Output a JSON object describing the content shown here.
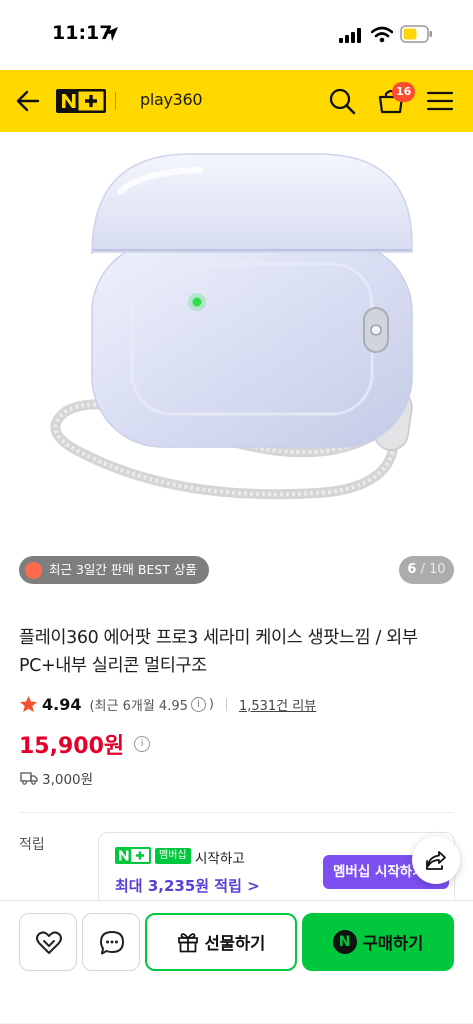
{
  "status_bar": {
    "time": "11:17"
  },
  "header": {
    "logo_text": "N+",
    "store_name": "play360",
    "cart_count": "16",
    "brand_color": "#ffd800"
  },
  "gallery": {
    "badge": "최근 3일간 판매 BEST 상품",
    "current": "6",
    "total": "/ 10"
  },
  "product": {
    "title": "플레이360 에어팟 프로3 세라미 케이스 생팟느낌 / 외부 PC+내부 실리콘 멀티구조",
    "rating": "4.94",
    "recent_rating_prefix": "(최근 6개월 4.95",
    "recent_rating_suffix": ")",
    "review_count": "1,531건 리뷰",
    "price": "15,900원",
    "delivery_fee": "3,000원",
    "accent_color": "#e4002b"
  },
  "points": {
    "label": "적립",
    "chip": "멤버십",
    "start_text": "시작하고",
    "max_text": "최대 3,235원 적립 >",
    "cta": "멤버십 시작하기"
  },
  "bottom_bar": {
    "gift_label": "선물하기",
    "buy_label": "구매하기",
    "buy_color": "#00c73c"
  }
}
